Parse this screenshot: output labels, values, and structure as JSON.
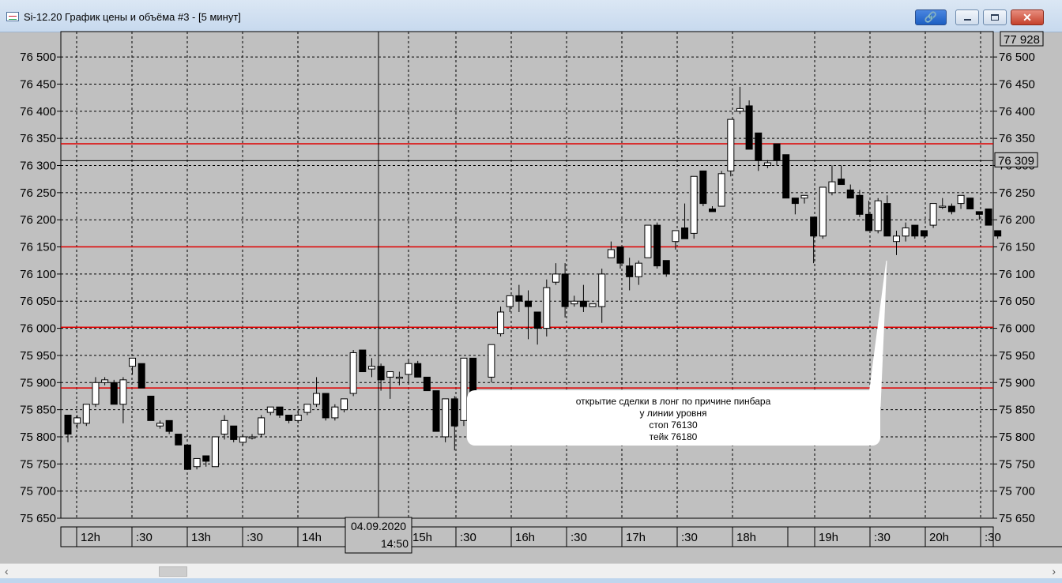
{
  "window": {
    "title": "Si-12.20 График цены и объёма #3 - [5 минут]"
  },
  "colors": {
    "bg": "#c0c0c0",
    "level_line": "#e00000",
    "grid": "#000000",
    "accent": "#1c5ec2"
  },
  "chart_data": {
    "type": "candlestick",
    "y_ticks": [
      "76 500",
      "76 450",
      "76 400",
      "76 350",
      "76 300",
      "76 250",
      "76 200",
      "76 150",
      "76 100",
      "76 050",
      "76 000",
      "75 950",
      "75 900",
      "75 850",
      "75 800",
      "75 750",
      "75 700",
      "75 650"
    ],
    "ylim": [
      75650,
      76520
    ],
    "x_ticks": [
      "12h",
      ":30",
      "13h",
      ":30",
      "14h",
      "15h",
      ":30",
      "16h",
      ":30",
      "17h",
      ":30",
      "18h",
      "19h",
      ":30",
      "20h",
      ":30"
    ],
    "top_value_label": "77 928",
    "current_price_label": "76 309",
    "crosshair_date": "04.09.2020",
    "crosshair_time": "14:50",
    "levels": [
      76340,
      76150,
      76002,
      75890
    ],
    "candles": [
      [
        75840,
        75840,
        75790,
        75805
      ],
      [
        75825,
        75840,
        75815,
        75835
      ],
      [
        75825,
        75860,
        75820,
        75860
      ],
      [
        75860,
        75910,
        75855,
        75900
      ],
      [
        75900,
        75910,
        75895,
        75905
      ],
      [
        75900,
        75905,
        75860,
        75860
      ],
      [
        75860,
        75910,
        75825,
        75905
      ],
      [
        75930,
        75945,
        75915,
        75945
      ],
      [
        75935,
        75935,
        75890,
        75890
      ],
      [
        75875,
        75875,
        75830,
        75830
      ],
      [
        75820,
        75830,
        75815,
        75825
      ],
      [
        75830,
        75830,
        75805,
        75810
      ],
      [
        75805,
        75805,
        75785,
        75785
      ],
      [
        75785,
        75785,
        75740,
        75740
      ],
      [
        75745,
        75760,
        75740,
        75760
      ],
      [
        75765,
        75765,
        75745,
        75755
      ],
      [
        75745,
        75800,
        75745,
        75800
      ],
      [
        75805,
        75840,
        75795,
        75830
      ],
      [
        75820,
        75820,
        75790,
        75795
      ],
      [
        75790,
        75805,
        75785,
        75800
      ],
      [
        75800,
        75805,
        75795,
        75800
      ],
      [
        75805,
        75840,
        75800,
        75835
      ],
      [
        75845,
        75855,
        75840,
        75855
      ],
      [
        75855,
        75855,
        75835,
        75840
      ],
      [
        75840,
        75840,
        75825,
        75830
      ],
      [
        75830,
        75850,
        75825,
        75840
      ],
      [
        75845,
        75860,
        75840,
        75860
      ],
      [
        75860,
        75910,
        75855,
        75880
      ],
      [
        75880,
        75880,
        75830,
        75835
      ],
      [
        75835,
        75860,
        75830,
        75855
      ],
      [
        75850,
        75870,
        75845,
        75870
      ],
      [
        75880,
        75960,
        75875,
        75955
      ],
      [
        75960,
        75960,
        75920,
        75920
      ],
      [
        75925,
        75945,
        75910,
        75930
      ],
      [
        75930,
        75935,
        75885,
        75905
      ],
      [
        75910,
        75920,
        75870,
        75920
      ],
      [
        75910,
        75920,
        75895,
        75910
      ],
      [
        75915,
        75940,
        75900,
        75935
      ],
      [
        75935,
        75940,
        75910,
        75910
      ],
      [
        75910,
        75910,
        75885,
        75885
      ],
      [
        75885,
        75885,
        75810,
        75810
      ],
      [
        75800,
        75870,
        75790,
        75870
      ],
      [
        75870,
        75875,
        75775,
        75820
      ],
      [
        75830,
        75945,
        75820,
        75945
      ],
      [
        75945,
        75945,
        75870,
        75870
      ],
      [
        75880,
        75880,
        75840,
        75850
      ],
      [
        75910,
        75970,
        75900,
        75970
      ],
      [
        75990,
        76040,
        75985,
        76030
      ],
      [
        76040,
        76060,
        76030,
        76060
      ],
      [
        76060,
        76080,
        76030,
        76050
      ],
      [
        76050,
        76070,
        75980,
        76040
      ],
      [
        76030,
        76030,
        75970,
        76000
      ],
      [
        76000,
        76090,
        75985,
        76075
      ],
      [
        76085,
        76120,
        76080,
        76100
      ],
      [
        76100,
        76120,
        76020,
        76040
      ],
      [
        76045,
        76060,
        76040,
        76050
      ],
      [
        76050,
        76080,
        76030,
        76040
      ],
      [
        76040,
        76045,
        76040,
        76045
      ],
      [
        76040,
        76110,
        76010,
        76100
      ],
      [
        76130,
        76160,
        76130,
        76145
      ],
      [
        76150,
        76150,
        76110,
        76120
      ],
      [
        76115,
        76130,
        76070,
        76095
      ],
      [
        76095,
        76125,
        76080,
        76120
      ],
      [
        76130,
        76190,
        76130,
        76190
      ],
      [
        76190,
        76195,
        76110,
        76115
      ],
      [
        76125,
        76125,
        76095,
        76100
      ],
      [
        76160,
        76180,
        76145,
        76180
      ],
      [
        76185,
        76230,
        76165,
        76165
      ],
      [
        76175,
        76280,
        76165,
        76280
      ],
      [
        76290,
        76290,
        76225,
        76230
      ],
      [
        76220,
        76225,
        76215,
        76215
      ],
      [
        76225,
        76290,
        76225,
        76285
      ],
      [
        76290,
        76380,
        76280,
        76385
      ],
      [
        76400,
        76445,
        76395,
        76405
      ],
      [
        76410,
        76420,
        76330,
        76330
      ],
      [
        76360,
        76360,
        76290,
        76310
      ],
      [
        76300,
        76310,
        76295,
        76305
      ],
      [
        76340,
        76340,
        76300,
        76310
      ],
      [
        76320,
        76320,
        76240,
        76240
      ],
      [
        76240,
        76240,
        76210,
        76230
      ],
      [
        76240,
        76245,
        76230,
        76245
      ],
      [
        76205,
        76205,
        76120,
        76170
      ],
      [
        76170,
        76260,
        76165,
        76260
      ],
      [
        76250,
        76300,
        76245,
        76270
      ],
      [
        76275,
        76300,
        76265,
        76265
      ],
      [
        76255,
        76265,
        76240,
        76240
      ],
      [
        76245,
        76255,
        76205,
        76210
      ],
      [
        76210,
        76235,
        76180,
        76180
      ],
      [
        76180,
        76240,
        76175,
        76235
      ],
      [
        76230,
        76245,
        76180,
        76170
      ],
      [
        76160,
        76180,
        76135,
        76170
      ],
      [
        76170,
        76195,
        76160,
        76185
      ],
      [
        76190,
        76190,
        76165,
        76170
      ],
      [
        76180,
        76180,
        76165,
        76170
      ],
      [
        76190,
        76230,
        76185,
        76230
      ],
      [
        76225,
        76240,
        76220,
        76225
      ],
      [
        76225,
        76230,
        76210,
        76215
      ],
      [
        76230,
        76245,
        76220,
        76245
      ],
      [
        76240,
        76240,
        76220,
        76220
      ],
      [
        76215,
        76215,
        76200,
        76210
      ],
      [
        76220,
        76220,
        76190,
        76190
      ],
      [
        76180,
        76180,
        76165,
        76170
      ]
    ],
    "annotation_lines": [
      "открытие сделки в лонг по причине пинбара",
      "у линии уровня",
      "стоп  76130",
      "тейк 76180"
    ]
  }
}
